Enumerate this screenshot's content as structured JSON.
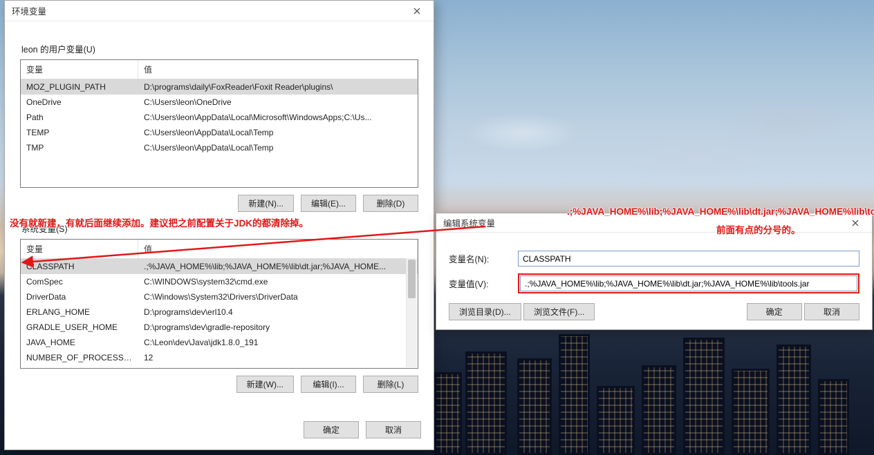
{
  "env_dialog": {
    "title": "环境变量",
    "user_section_label": "leon 的用户变量(U)",
    "sys_section_label": "系统变量(S)",
    "col_var": "变量",
    "col_val": "值",
    "btn_new_u": "新建(N)...",
    "btn_edit_u": "编辑(E)...",
    "btn_del_u": "删除(D)",
    "btn_new_s": "新建(W)...",
    "btn_edit_s": "编辑(I)...",
    "btn_del_s": "删除(L)",
    "btn_ok": "确定",
    "btn_cancel": "取消",
    "user_vars": [
      {
        "name": "MOZ_PLUGIN_PATH",
        "value": "D:\\programs\\daily\\FoxReader\\Foxit Reader\\plugins\\",
        "selected": true
      },
      {
        "name": "OneDrive",
        "value": "C:\\Users\\leon\\OneDrive"
      },
      {
        "name": "Path",
        "value": "C:\\Users\\leon\\AppData\\Local\\Microsoft\\WindowsApps;C:\\Us..."
      },
      {
        "name": "TEMP",
        "value": "C:\\Users\\leon\\AppData\\Local\\Temp"
      },
      {
        "name": "TMP",
        "value": "C:\\Users\\leon\\AppData\\Local\\Temp"
      }
    ],
    "sys_vars": [
      {
        "name": "CLASSPATH",
        "value": ".;%JAVA_HOME%\\lib;%JAVA_HOME%\\lib\\dt.jar;%JAVA_HOME...",
        "selected": true
      },
      {
        "name": "ComSpec",
        "value": "C:\\WINDOWS\\system32\\cmd.exe"
      },
      {
        "name": "DriverData",
        "value": "C:\\Windows\\System32\\Drivers\\DriverData"
      },
      {
        "name": "ERLANG_HOME",
        "value": "D:\\programs\\dev\\erl10.4"
      },
      {
        "name": "GRADLE_USER_HOME",
        "value": "D:\\programs\\dev\\gradle-repository"
      },
      {
        "name": "JAVA_HOME",
        "value": "C:\\Leon\\dev\\Java\\jdk1.8.0_191"
      },
      {
        "name": "NUMBER_OF_PROCESSORS",
        "value": "12"
      }
    ]
  },
  "edit_dialog": {
    "title": "编辑系统变量",
    "name_label": "变量名(N):",
    "value_label": "变量值(V):",
    "name_value": "CLASSPATH",
    "value_value": ".;%JAVA_HOME%\\lib;%JAVA_HOME%\\lib\\dt.jar;%JAVA_HOME%\\lib\\tools.jar",
    "btn_browse_dir": "浏览目录(D)...",
    "btn_browse_file": "浏览文件(F)...",
    "btn_ok": "确定",
    "btn_cancel": "取消"
  },
  "annotations": {
    "a1": "没有就新建，有就后面继续添加。建议把之前配置关于JDK的都清除掉。",
    "a2": ".;%JAVA_HOME%\\lib;%JAVA_HOME%\\lib\\dt.jar;%JAVA_HOME%\\lib\\tool",
    "a3": "前面有点的分号的。"
  }
}
